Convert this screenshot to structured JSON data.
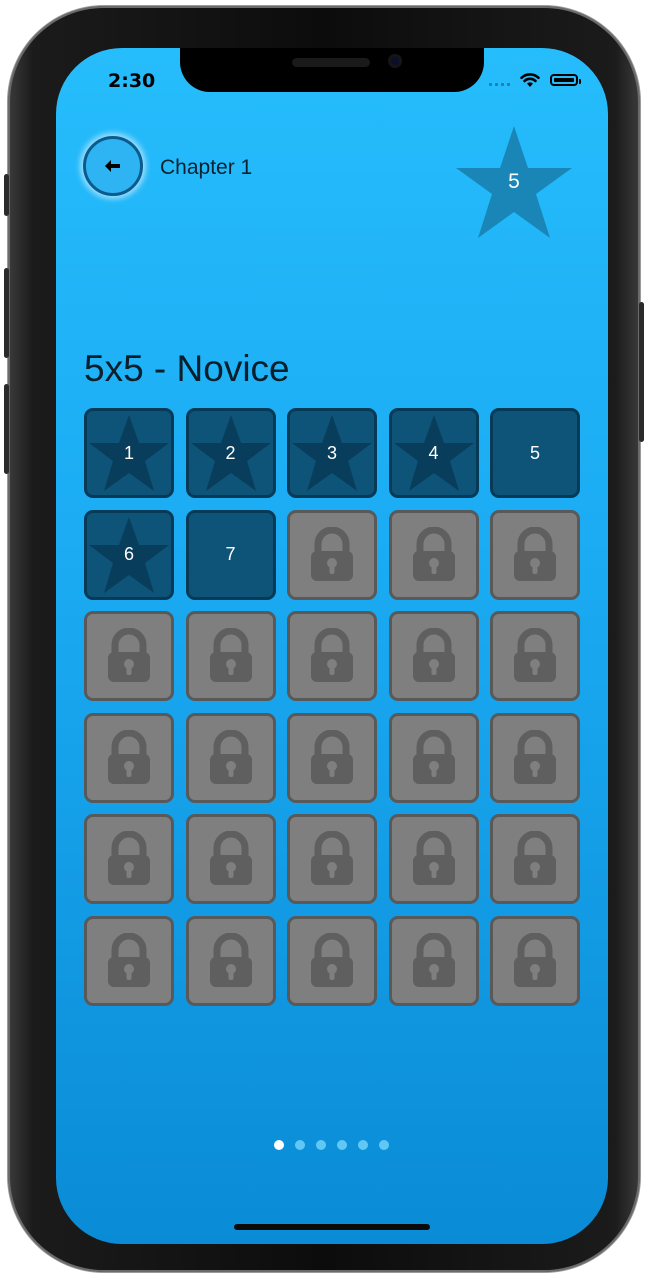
{
  "status_bar": {
    "time": "2:30"
  },
  "header": {
    "back_icon": "left-arrow-icon",
    "chapter_label": "Chapter 1",
    "star_count": "5",
    "star_icon": "star-icon"
  },
  "level_pack": {
    "title": "5x5 - Novice",
    "levels": [
      {
        "label": "1",
        "state": "completed"
      },
      {
        "label": "2",
        "state": "completed"
      },
      {
        "label": "3",
        "state": "completed"
      },
      {
        "label": "4",
        "state": "completed"
      },
      {
        "label": "5",
        "state": "unlocked"
      },
      {
        "label": "6",
        "state": "completed"
      },
      {
        "label": "7",
        "state": "unlocked"
      },
      {
        "label": "",
        "state": "locked"
      },
      {
        "label": "",
        "state": "locked"
      },
      {
        "label": "",
        "state": "locked"
      },
      {
        "label": "",
        "state": "locked"
      },
      {
        "label": "",
        "state": "locked"
      },
      {
        "label": "",
        "state": "locked"
      },
      {
        "label": "",
        "state": "locked"
      },
      {
        "label": "",
        "state": "locked"
      },
      {
        "label": "",
        "state": "locked"
      },
      {
        "label": "",
        "state": "locked"
      },
      {
        "label": "",
        "state": "locked"
      },
      {
        "label": "",
        "state": "locked"
      },
      {
        "label": "",
        "state": "locked"
      },
      {
        "label": "",
        "state": "locked"
      },
      {
        "label": "",
        "state": "locked"
      },
      {
        "label": "",
        "state": "locked"
      },
      {
        "label": "",
        "state": "locked"
      },
      {
        "label": "",
        "state": "locked"
      },
      {
        "label": "",
        "state": "locked"
      },
      {
        "label": "",
        "state": "locked"
      },
      {
        "label": "",
        "state": "locked"
      },
      {
        "label": "",
        "state": "locked"
      },
      {
        "label": "",
        "state": "locked"
      }
    ]
  },
  "pager": {
    "pages": 6,
    "active_index": 0
  },
  "colors": {
    "background_top": "#26bdfc",
    "background_bottom": "#0a8bd5",
    "completed_tile": "#0e5478",
    "locked_tile": "#7f7f7f",
    "star_badge": "#1a86b8"
  }
}
